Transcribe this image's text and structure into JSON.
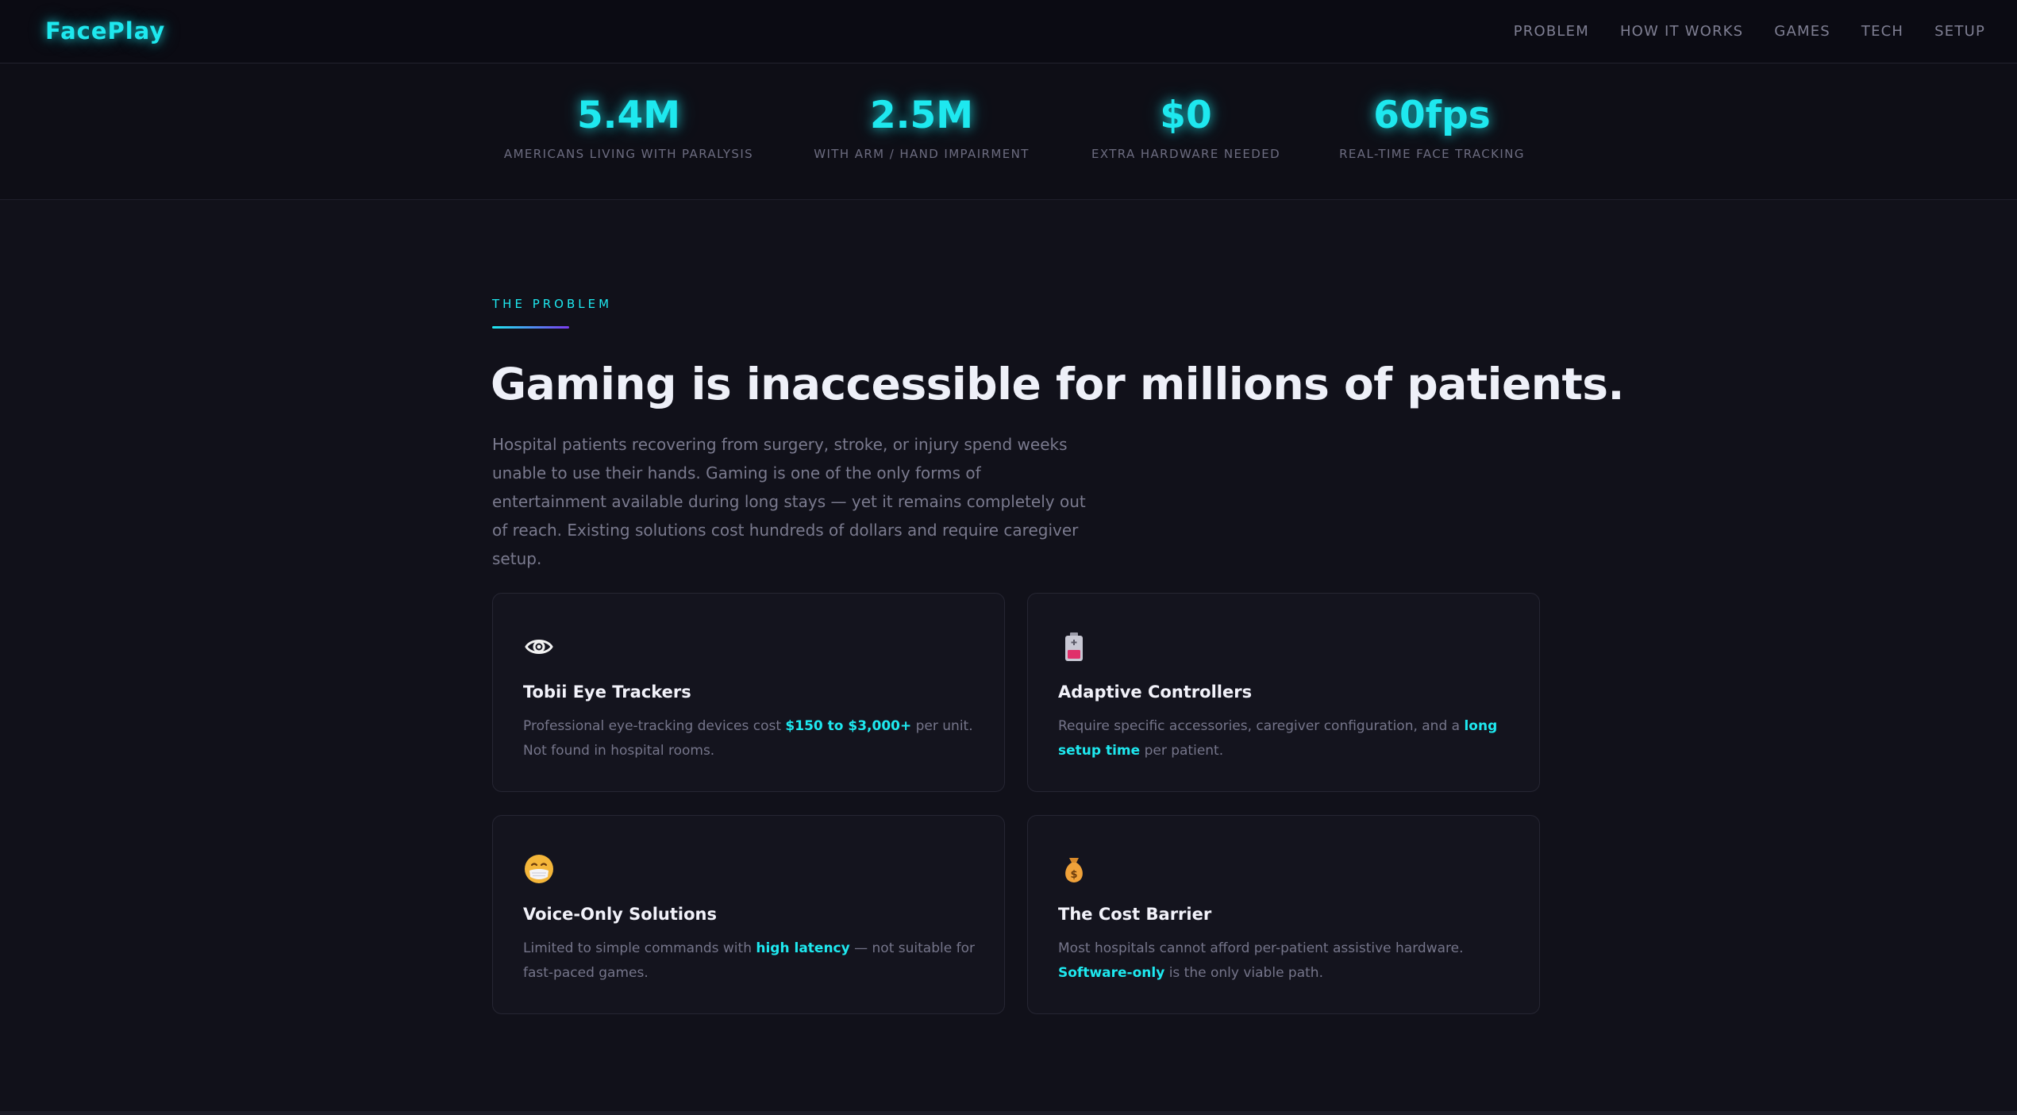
{
  "nav": {
    "logo": "FacePlay",
    "links": [
      {
        "label": "PROBLEM"
      },
      {
        "label": "HOW IT WORKS"
      },
      {
        "label": "GAMES"
      },
      {
        "label": "TECH"
      },
      {
        "label": "SETUP"
      }
    ]
  },
  "stats": [
    {
      "value": "5.4M",
      "label": "AMERICANS LIVING WITH PARALYSIS"
    },
    {
      "value": "2.5M",
      "label": "WITH ARM / HAND IMPAIRMENT"
    },
    {
      "value": "$0",
      "label": "EXTRA HARDWARE NEEDED"
    },
    {
      "value": "60fps",
      "label": "REAL-TIME FACE TRACKING"
    }
  ],
  "problem": {
    "eyebrow": "THE PROBLEM",
    "headline": "Gaming is inaccessible for millions of patients.",
    "lead": "Hospital patients recovering from surgery, stroke, or injury spend weeks unable to use their hands. Gaming is one of the only forms of entertainment available during long stays — yet it remains completely out of reach. Existing solutions cost hundreds of dollars and require caregiver setup."
  },
  "cards": [
    {
      "icon": "eye-icon",
      "title": "Tobii Eye Trackers",
      "text_before": "Professional eye-tracking devices cost ",
      "highlight": "$150 to $3,000+",
      "text_after": " per unit. Not found in hospital rooms."
    },
    {
      "icon": "battery-icon",
      "title": "Adaptive Controllers",
      "text_before": "Require specific accessories, caregiver configuration, and a ",
      "highlight": "long setup time",
      "text_after": " per patient."
    },
    {
      "icon": "face-mask-icon",
      "title": "Voice-Only Solutions",
      "text_before": "Limited to simple commands with ",
      "highlight": "high latency",
      "text_after": " — not suitable for fast-paced games."
    },
    {
      "icon": "money-bag-icon",
      "title": "The Cost Barrier",
      "text_before": "Most hospitals cannot afford per-patient assistive hardware. ",
      "highlight": "Software-only",
      "text_after": " is the only viable path."
    }
  ],
  "colors": {
    "accent": "#1ee8ef",
    "accent_secondary": "#7b3cf0",
    "background": "#11111a",
    "card": "#14141e"
  }
}
